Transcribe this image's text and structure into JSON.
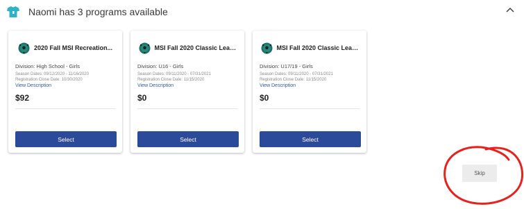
{
  "header": {
    "title": "Naomi has 3 programs available",
    "icon": "shirt-icon",
    "icon_color": "#2bb3c7"
  },
  "programs": [
    {
      "title": "2020 Fall MSI Recreation...",
      "division": "Division: High School - Girls",
      "season_dates": "Season Dates: 09/12/2020 - 11/16/2020",
      "registration_close": "Registration Close Date: 10/30/2020",
      "view_description": "View Description",
      "price": "$92",
      "select_label": "Select"
    },
    {
      "title": "MSI Fall 2020 Classic Leag...",
      "division": "Division: U16 - Girls",
      "season_dates": "Season Dates: 09/11/2020 - 07/31/2021",
      "registration_close": "Registration Close Date: 11/15/2020",
      "view_description": "View Description",
      "price": "$0",
      "select_label": "Select"
    },
    {
      "title": "MSI Fall 2020 Classic Leag...",
      "division": "Division: U17/19 - Girls",
      "season_dates": "Season Dates: 09/11/2020 - 07/31/2021",
      "registration_close": "Registration Close Date: 11/15/2020",
      "view_description": "View Description",
      "price": "$0",
      "select_label": "Select"
    }
  ],
  "skip_label": "Skip",
  "colors": {
    "button": "#2c4a9a",
    "link": "#3555a8",
    "annotation": "#e8211c"
  }
}
